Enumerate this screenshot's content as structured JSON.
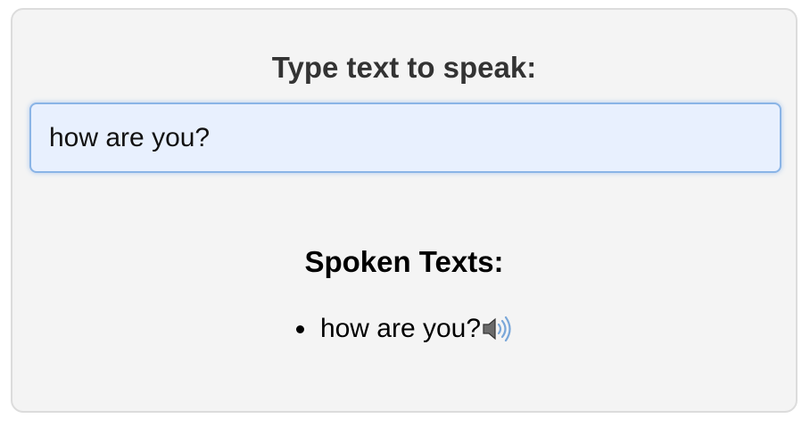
{
  "prompt": {
    "label": "Type text to speak:"
  },
  "input": {
    "value": "how are you?"
  },
  "spoken": {
    "heading": "Spoken Texts:",
    "items": [
      {
        "text": "how are you?",
        "icon": "speaker-icon"
      }
    ]
  }
}
